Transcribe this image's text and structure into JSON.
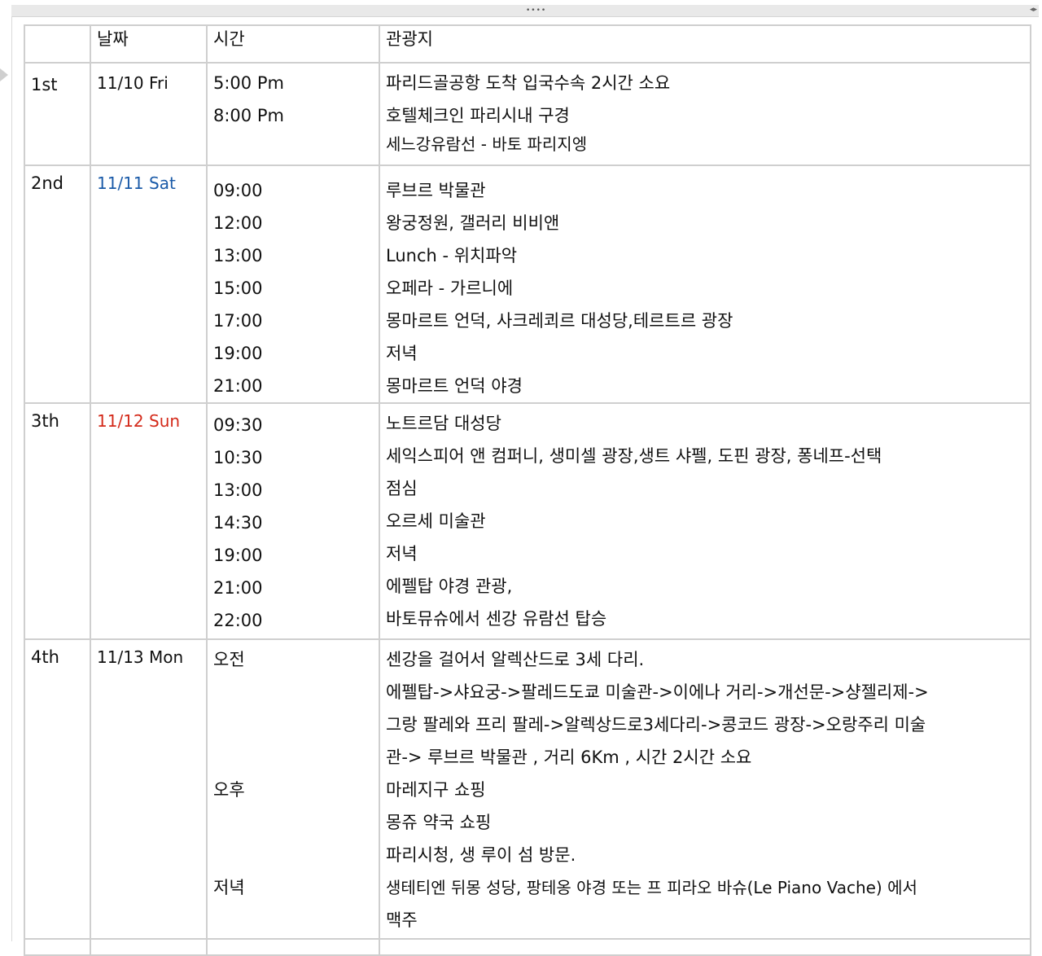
{
  "header": {
    "day": "",
    "date": "날짜",
    "time": "시간",
    "place": "관광지"
  },
  "days": [
    {
      "day": "1st",
      "date": "11/10 Fri",
      "times": [
        "5:00 Pm",
        "8:00 Pm",
        ""
      ],
      "places": [
        "파리드골공항 도착 입국수속 2시간 소요",
        "호텔체크인 파리시내 구경",
        "세느강유람선 - 바토 파리지엥"
      ]
    },
    {
      "day": "2nd",
      "date": "11/11 Sat",
      "times": [
        "09:00",
        "12:00",
        "13:00",
        "15:00",
        "17:00",
        "19:00",
        "21:00"
      ],
      "places": [
        "루브르 박물관",
        "왕궁정원, 갤러리 비비앤",
        "Lunch - 위치파악",
        "오페라 - 가르니에",
        "몽마르트 언덕, 사크레쾨르 대성당,테르트르 광장",
        "저녁",
        "몽마르트 언덕 야경"
      ]
    },
    {
      "day": "3th",
      "date": "11/12 Sun",
      "times": [
        "09:30",
        "10:30",
        "13:00",
        "14:30",
        "19:00",
        "21:00",
        "22:00"
      ],
      "places": [
        "노트르담 대성당",
        "세익스피어 앤 컴퍼니, 생미셀 광장,생트 샤펠, 도핀 광장, 퐁네프-선택",
        "점심",
        "오르세 미술관",
        "저녁",
        "에펠탑 야경 관광,",
        "바토뮤슈에서 센강 유람선 탑승"
      ]
    },
    {
      "day": "4th",
      "date": "11/13 Mon",
      "times": [
        "오전",
        "",
        "",
        "",
        "오후",
        "",
        "",
        "저녁",
        ""
      ],
      "places": [
        "센강을 걸어서 알렉산드로 3세 다리.",
        "에펠탑->샤요궁->팔레드도쿄 미술관->이에나 거리->개선문->샹젤리제->",
        "그랑 팔레와 프리 팔레->알렉상드로3세다리->콩코드 광장->오랑주리 미술",
        "관-> 루브르 박물관 , 거리 6Km , 시간 2시간 소요",
        "마레지구 쇼핑",
        "몽쥬 약국 쇼핑",
        "파리시청, 생 루이 섬 방문.",
        "생테티엔 뒤몽 성당, 팡테옹 야경 또는 프 피라오 바슈(Le Piano Vache) 에서",
        "맥주"
      ]
    }
  ],
  "colors": {
    "sat": "#1a5aa8",
    "sun": "#d42a1a",
    "border": "#cfcfcf"
  }
}
